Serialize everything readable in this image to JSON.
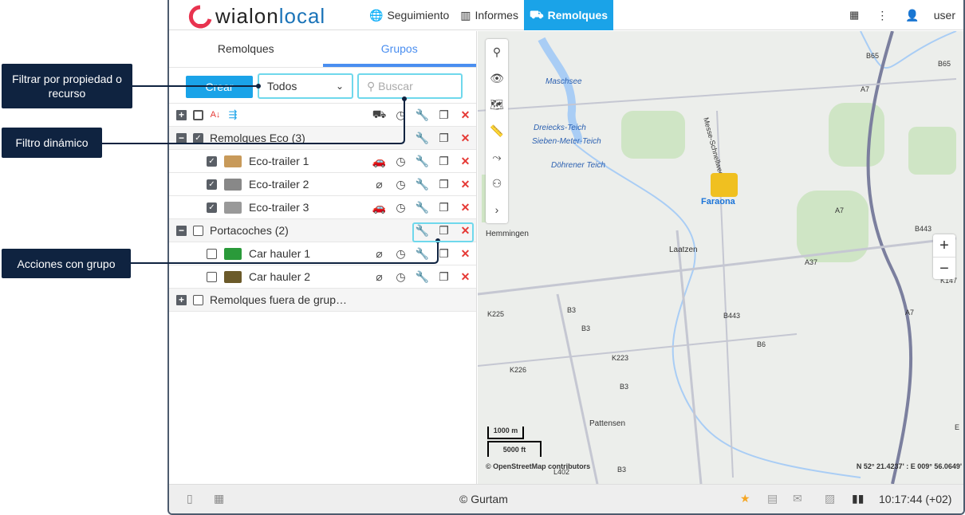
{
  "header": {
    "logo": "wialonlocal",
    "nav": [
      {
        "label": "Seguimiento",
        "icon": "globe-icon"
      },
      {
        "label": "Informes",
        "icon": "report-icon"
      },
      {
        "label": "Remolques",
        "icon": "trailer-icon",
        "active": true
      }
    ],
    "user": "user"
  },
  "panel": {
    "tabs": [
      "Remolques",
      "Grupos"
    ],
    "active_tab": "Grupos",
    "create_label": "Crear",
    "filter_value": "Todos",
    "search_placeholder": "Buscar",
    "groups": [
      {
        "name": "Remolques Eco (3)",
        "expanded": true,
        "checked": true,
        "items": [
          {
            "name": "Eco-trailer 1",
            "checked": true,
            "status": "car-yellow"
          },
          {
            "name": "Eco-trailer 2",
            "checked": true,
            "status": "unlinked"
          },
          {
            "name": "Eco-trailer 3",
            "checked": true,
            "status": "car-yellow"
          }
        ]
      },
      {
        "name": "Portacoches (2)",
        "expanded": true,
        "checked": false,
        "items": [
          {
            "name": "Car hauler 1",
            "checked": false,
            "status": "unlinked"
          },
          {
            "name": "Car hauler 2",
            "checked": false,
            "status": "unlinked"
          }
        ]
      },
      {
        "name": "Remolques fuera de grup…",
        "expanded": false,
        "checked": false,
        "items": []
      }
    ]
  },
  "map": {
    "places": [
      "Maschsee",
      "Dreiecks-Teich",
      "Sieben-Meter-Teich",
      "Döhrener Teich",
      "Hemmingen",
      "Laatzen",
      "Pattensen",
      "Messe-Schnellweg"
    ],
    "roads": [
      "B65",
      "B65",
      "A7",
      "A7",
      "A7",
      "B443",
      "A37",
      "K147",
      "K225",
      "B3",
      "B3",
      "K223",
      "K226",
      "B3",
      "B443",
      "B6",
      "L402",
      "B3",
      "E"
    ],
    "unit_label": "Faraona",
    "scale_m": "1000 m",
    "scale_ft": "5000 ft",
    "attribution": "© OpenStreetMap contributors",
    "coords": "N 52° 21.4237' : E 009° 56.0649'"
  },
  "footer": {
    "copyright": "© Gurtam",
    "time": "10:17:44 (+02)"
  },
  "callouts": {
    "filter": "Filtrar por propiedad o recurso",
    "dynamic": "Filtro dinámico",
    "actions": "Acciones con grupo"
  },
  "colors": {
    "accent": "#1aa3e8",
    "tab": "#4a8ef0",
    "callout": "#0f2340",
    "highlight": "#6fd8ec"
  }
}
